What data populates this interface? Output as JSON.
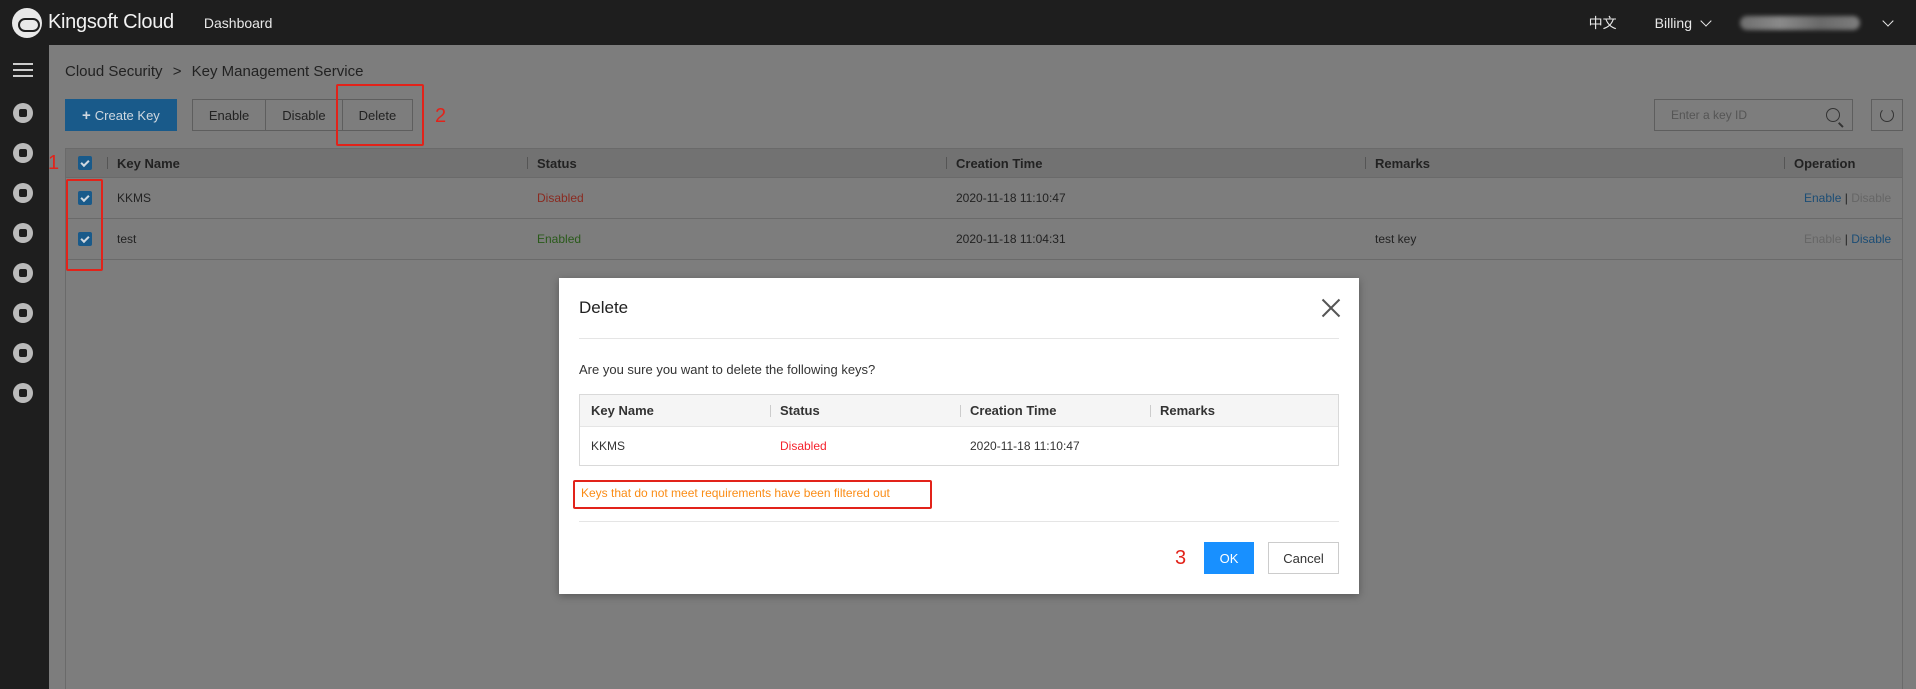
{
  "header": {
    "brand": "Kingsoft Cloud",
    "nav_dashboard": "Dashboard",
    "language": "中文",
    "billing": "Billing"
  },
  "sidebar": {
    "icons": [
      "menu-icon",
      "shield-icon",
      "user-icon",
      "server-icon",
      "database-icon",
      "storage-icon",
      "network-icon",
      "cloud-icon",
      "monitor-icon"
    ]
  },
  "breadcrumb": {
    "parent": "Cloud Security",
    "separator": ">",
    "current": "Key Management Service"
  },
  "toolbar": {
    "create_label": "Create Key",
    "enable_label": "Enable",
    "disable_label": "Disable",
    "delete_label": "Delete",
    "search_placeholder": "Enter a key ID"
  },
  "table": {
    "headers": {
      "name": "Key Name",
      "status": "Status",
      "created": "Creation Time",
      "remarks": "Remarks",
      "operation": "Operation"
    },
    "rows": [
      {
        "name": "KKMS",
        "status": "Disabled",
        "created": "2020-11-18 11:10:47",
        "remarks": "",
        "op_enable": "Enable",
        "op_sep": "|",
        "op_disable": "Disable"
      },
      {
        "name": "test",
        "status": "Enabled",
        "created": "2020-11-18 11:04:31",
        "remarks": "test key",
        "op_enable": "Enable",
        "op_sep": "|",
        "op_disable": "Disable"
      }
    ]
  },
  "annotations": {
    "n1": "1",
    "n2": "2",
    "n3": "3"
  },
  "modal": {
    "title": "Delete",
    "question": "Are you sure you want to delete the following keys?",
    "headers": {
      "name": "Key Name",
      "status": "Status",
      "created": "Creation Time",
      "remarks": "Remarks"
    },
    "rows": [
      {
        "name": "KKMS",
        "status": "Disabled",
        "created": "2020-11-18 11:10:47",
        "remarks": ""
      }
    ],
    "warning": "Keys that do not meet requirements have been filtered out",
    "ok_label": "OK",
    "cancel_label": "Cancel"
  },
  "colors": {
    "primary": "#1890ff",
    "disabled_status": "#f5222d",
    "warning": "#fa8c16",
    "annotation": "#e2231a"
  }
}
